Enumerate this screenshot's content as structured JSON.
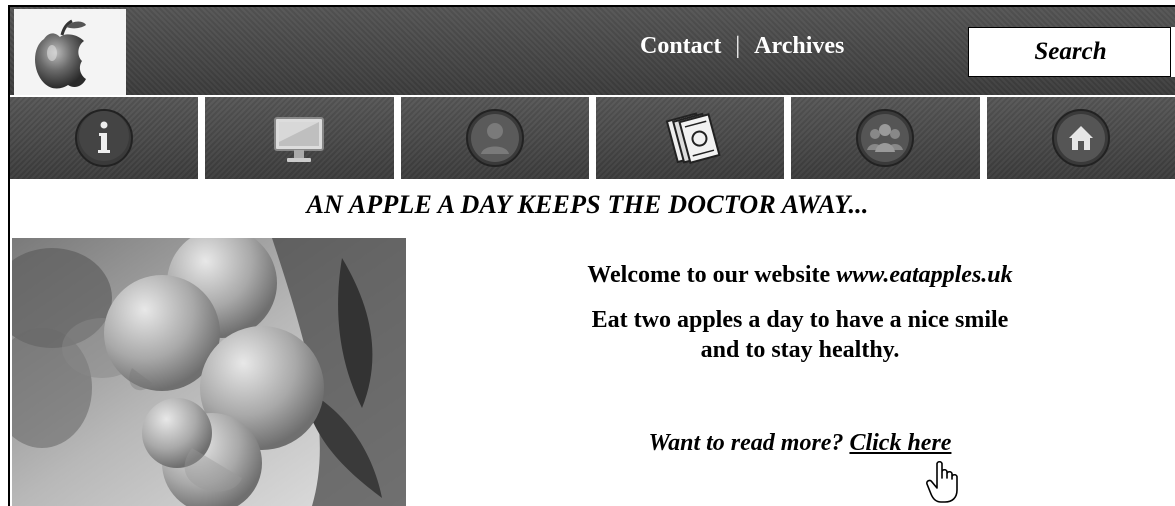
{
  "header": {
    "nav": {
      "contact": "Contact",
      "separator": "|",
      "archives": "Archives"
    },
    "search": {
      "placeholder": "Search"
    }
  },
  "iconbar": {
    "items": [
      {
        "icon": "info-icon"
      },
      {
        "icon": "monitor-icon"
      },
      {
        "icon": "user-icon"
      },
      {
        "icon": "money-icon"
      },
      {
        "icon": "group-icon"
      },
      {
        "icon": "home-icon"
      }
    ]
  },
  "main": {
    "tagline": "AN APPLE A DAY KEEPS THE DOCTOR AWAY...",
    "welcome_prefix": "Welcome to our website ",
    "welcome_url": "www.eatapples.uk",
    "eat_line1": "Eat two apples a day to have a nice smile",
    "eat_line2": "and to stay healthy.",
    "read_more_prefix": "Want to read more? ",
    "read_more_link": "Click here"
  },
  "colors": {
    "header_bg": "#4a4a4a",
    "page_bg": "#ffffff",
    "text": "#000000"
  }
}
